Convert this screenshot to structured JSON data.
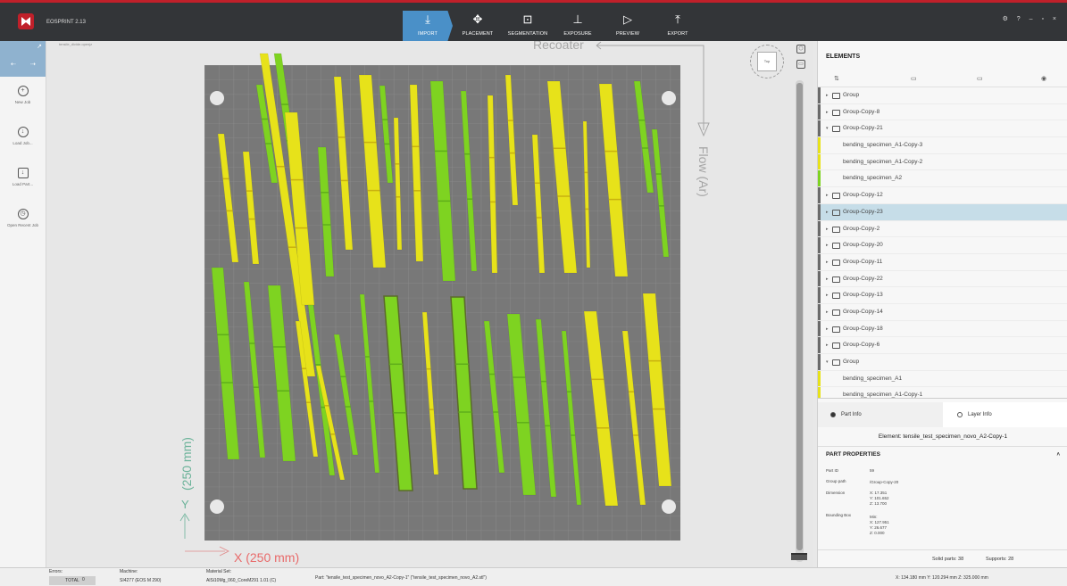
{
  "app": {
    "title": "EOSPRINT 2.13"
  },
  "tabs": [
    {
      "label": "IMPORT",
      "icon": "import-icon",
      "glyph": "⤓"
    },
    {
      "label": "PLACEMENT",
      "icon": "move-icon",
      "glyph": "✥"
    },
    {
      "label": "SEGMENTATION",
      "icon": "segmentation-icon",
      "glyph": "⊡"
    },
    {
      "label": "EXPOSURE",
      "icon": "exposure-icon",
      "glyph": "⊥"
    },
    {
      "label": "PREVIEW",
      "icon": "preview-icon",
      "glyph": "▷"
    },
    {
      "label": "EXPORT",
      "icon": "export-icon",
      "glyph": "⤒"
    }
  ],
  "window_controls": "⚙ ? – ▫ ×",
  "sidebar": {
    "back": "⇠",
    "forward": "⇢",
    "corner": "↗",
    "items": [
      {
        "label": "New Job",
        "icon": "plus-icon",
        "glyph": "+"
      },
      {
        "label": "Load Job...",
        "icon": "download-icon",
        "glyph": "↓"
      },
      {
        "label": "Load Part...",
        "icon": "load-part-icon",
        "glyph": "↓"
      },
      {
        "label": "Open Recent Job",
        "icon": "clock-icon",
        "glyph": "◷"
      }
    ]
  },
  "viewport": {
    "job_name": "tensile_divide.openjz",
    "recoater_label": "Recoater",
    "flow_label": "Flow (Ar)",
    "x_label": "X  (250 mm)",
    "y_label": "(250 mm)",
    "y_axis": "Y",
    "nav_cube_label": "Top",
    "parts": [
      {
        "color": "yellow",
        "p": [
          [
            291,
            60
          ],
          [
            300,
            60
          ],
          [
            353,
            422
          ],
          [
            344,
            422
          ]
        ]
      },
      {
        "color": "green",
        "p": [
          [
            307,
            60
          ],
          [
            315,
            60
          ],
          [
            338,
            223
          ],
          [
            330,
            223
          ]
        ]
      }
    ]
  },
  "elements": {
    "title": "ELEMENTS",
    "tree": [
      {
        "name": "Group",
        "type": "group",
        "bar": "#6a6a6a"
      },
      {
        "name": "Group-Copy-8",
        "type": "group",
        "bar": "#6a6a6a"
      },
      {
        "name": "Group-Copy-21",
        "type": "group-open",
        "bar": "#6a6a6a"
      },
      {
        "name": "bending_specimen_A1-Copy-3",
        "type": "part",
        "bar": "#e7e21a"
      },
      {
        "name": "bending_specimen_A1-Copy-2",
        "type": "part",
        "bar": "#e7e21a"
      },
      {
        "name": "bending_specimen_A2",
        "type": "part",
        "bar": "#7ed321"
      },
      {
        "name": "Group-Copy-12",
        "type": "group",
        "bar": "#6a6a6a"
      },
      {
        "name": "Group-Copy-23",
        "type": "group",
        "bar": "#6a6a6a",
        "selected": true
      },
      {
        "name": "Group-Copy-2",
        "type": "group",
        "bar": "#6a6a6a"
      },
      {
        "name": "Group-Copy-20",
        "type": "group",
        "bar": "#6a6a6a"
      },
      {
        "name": "Group-Copy-11",
        "type": "group",
        "bar": "#6a6a6a"
      },
      {
        "name": "Group-Copy-22",
        "type": "group",
        "bar": "#6a6a6a"
      },
      {
        "name": "Group-Copy-13",
        "type": "group",
        "bar": "#6a6a6a"
      },
      {
        "name": "Group-Copy-14",
        "type": "group",
        "bar": "#6a6a6a"
      },
      {
        "name": "Group-Copy-18",
        "type": "group",
        "bar": "#6a6a6a"
      },
      {
        "name": "Group-Copy-6",
        "type": "group",
        "bar": "#6a6a6a"
      },
      {
        "name": "Group",
        "type": "group-open",
        "bar": "#6a6a6a"
      },
      {
        "name": "bending_specimen_A1",
        "type": "part",
        "bar": "#e7e21a"
      },
      {
        "name": "bending_specimen_A1-Copy-1",
        "type": "part",
        "bar": "#e7e21a"
      }
    ]
  },
  "info_tabs": {
    "part": "Part Info",
    "layer": "Layer Info"
  },
  "element_caption": "Element: tensile_test_specimen_novo_A2-Copy-1",
  "properties": {
    "title": "PART PROPERTIES",
    "part_id_label": "Part ID",
    "part_id": "59",
    "group_path_label": "Group path",
    "group_path": "/Group-Copy-20",
    "dimension_label": "Dimension",
    "dim_x": "X: 17.351",
    "dim_y": "Y: 101.652",
    "dim_z": "Z: 13.700",
    "bbox_label": "Bounding Box",
    "bbox_min": "Min:",
    "bbox_x": "X: 127.951",
    "bbox_y": "Y: 26.677",
    "bbox_z": "Z: 0.000"
  },
  "footer": {
    "solid_parts": "Solid parts: 38",
    "supports": "Supports: 28"
  },
  "status": {
    "errors_label": "Errors:",
    "total_label": "TOTAL",
    "total_value": "0",
    "machine_label": "Machine:",
    "machine_value": "SI4277 (EOS M 290)",
    "material_label": "Material Set:",
    "material_value": "AlSi10Mg_060_CoreM291 1.01 (C)",
    "part_text": "Part: \"tensile_test_specimen_novo_A2-Copy-1\" (\"tensile_test_specimen_novo_A2.stl\")",
    "coords": "X: 134.180 mm   Y: 120.294 mm   Z: 325.000 mm"
  },
  "colors": {
    "accent": "#4a90c8",
    "brand": "#c0202a",
    "part_yellow": "#e7e21a",
    "part_green": "#7ed321",
    "plate": "#7a7a7a",
    "selected_row": "#c6dde8"
  }
}
